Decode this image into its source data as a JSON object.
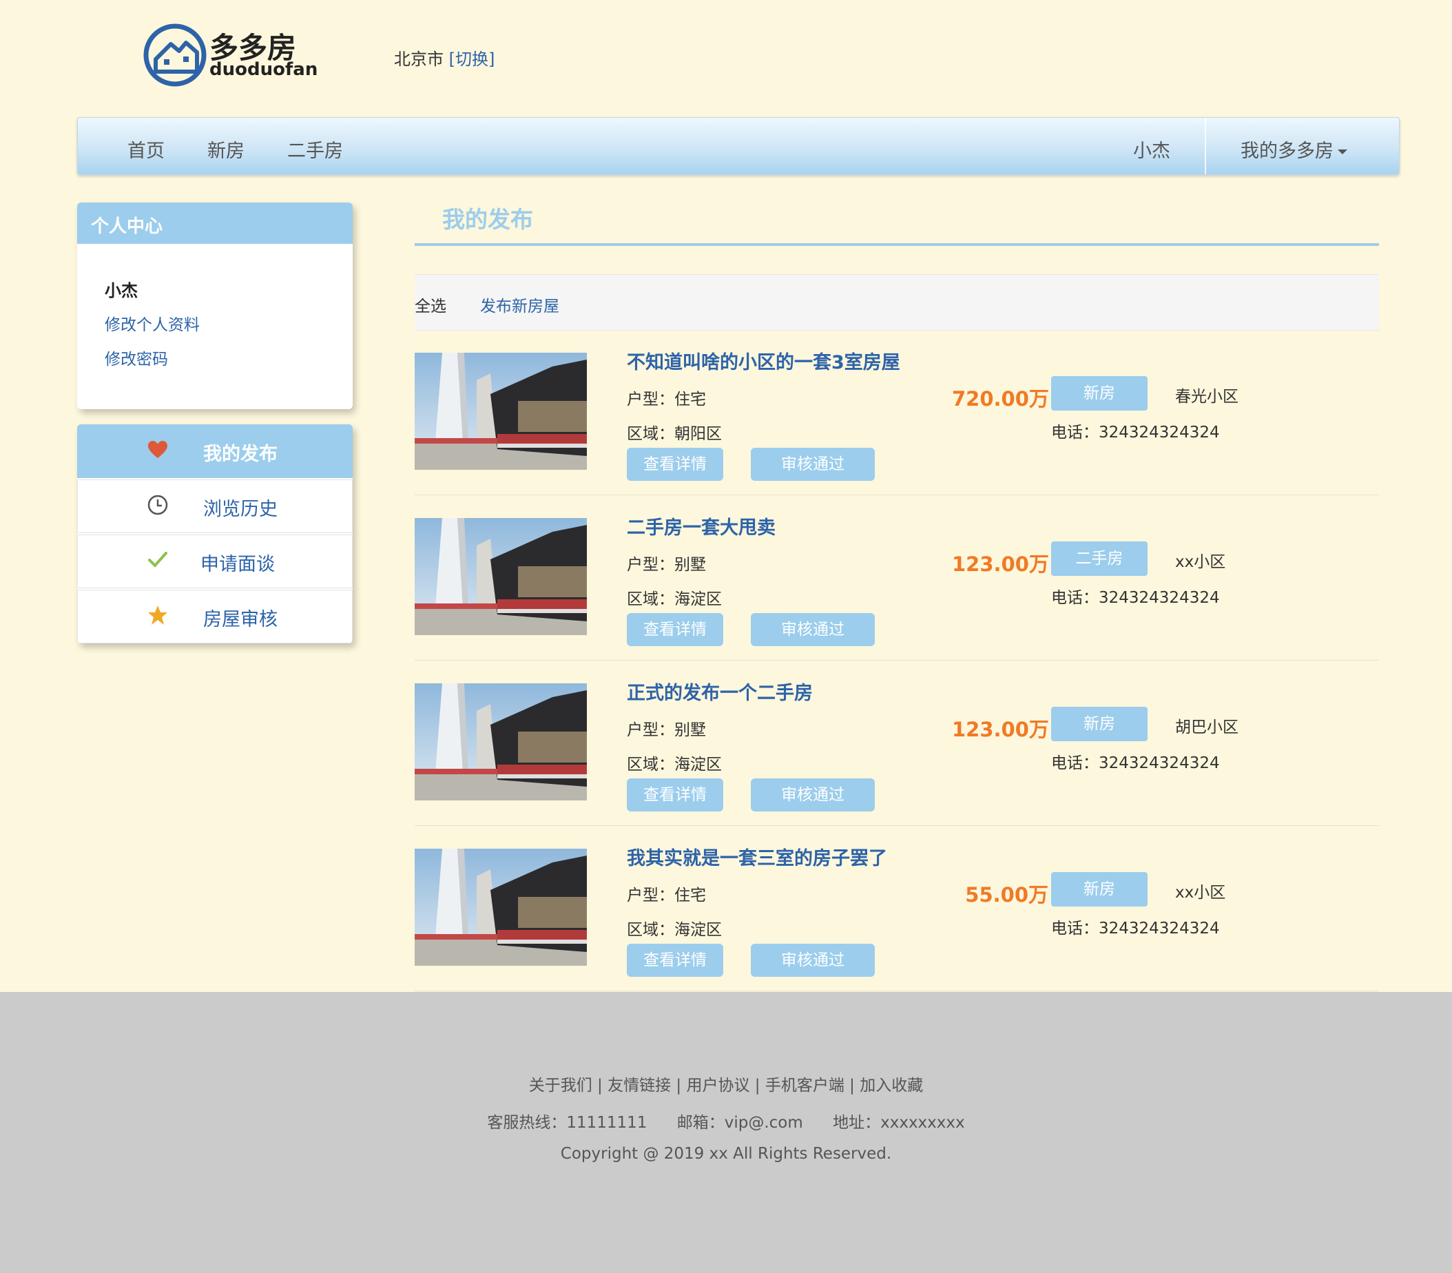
{
  "header": {
    "logo_cn": "多多房",
    "logo_en": "duoduofan",
    "city": "北京市",
    "city_switch": "[切换]"
  },
  "nav": {
    "items": [
      "首页",
      "新房",
      "二手房"
    ],
    "user": "小杰",
    "my_menu": "我的多多房"
  },
  "personal_center": {
    "title": "个人中心",
    "username": "小杰",
    "links": [
      "修改个人资料",
      "修改密码"
    ]
  },
  "side_menu": [
    {
      "label": "我的发布",
      "icon": "heart-icon",
      "color": "#e0583a"
    },
    {
      "label": "浏览历史",
      "icon": "clock-icon",
      "color": "#555555"
    },
    {
      "label": "申请面谈",
      "icon": "check-icon",
      "color": "#8cc24a"
    },
    {
      "label": "房屋审核",
      "icon": "star-icon",
      "color": "#f0a824"
    }
  ],
  "main": {
    "title": "我的发布",
    "toolbar": {
      "select_all": "全选",
      "publish": "发布新房屋"
    }
  },
  "listings": [
    {
      "title": "不知道叫啥的小区的一套3室房屋",
      "type": "户型：住宅",
      "area": "区域：朝阳区",
      "price": "720.00万",
      "tag": "新房",
      "community": "春光小区",
      "phone": "电话：324324324324",
      "detail_btn": "查看详情",
      "audit_btn": "审核通过"
    },
    {
      "title": "二手房一套大甩卖",
      "type": "户型：别墅",
      "area": "区域：海淀区",
      "price": "123.00万",
      "tag": "二手房",
      "community": "xx小区",
      "phone": "电话：324324324324",
      "detail_btn": "查看详情",
      "audit_btn": "审核通过"
    },
    {
      "title": "正式的发布一个二手房",
      "type": "户型：别墅",
      "area": "区域：海淀区",
      "price": "123.00万",
      "tag": "新房",
      "community": "胡巴小区",
      "phone": "电话：324324324324",
      "detail_btn": "查看详情",
      "audit_btn": "审核通过"
    },
    {
      "title": "我其实就是一套三室的房子罢了",
      "type": "户型：住宅",
      "area": "区域：海淀区",
      "price": "55.00万",
      "tag": "新房",
      "community": "xx小区",
      "phone": "电话：324324324324",
      "detail_btn": "查看详情",
      "audit_btn": "审核通过"
    }
  ],
  "footer": {
    "links": "关于我们 | 友情链接 | 用户协议 | 手机客户端 | 加入收藏",
    "hotline": "客服热线：11111111",
    "email": "邮箱：vip@.com",
    "address": "地址：xxxxxxxxx",
    "copyright": "Copyright @ 2019 xx All Rights Reserved."
  },
  "colors": {
    "accent": "#9ccdec",
    "link": "#2d63a8",
    "price": "#f07a25",
    "background": "#fdf7dd",
    "footer": "#cbcbcb"
  }
}
